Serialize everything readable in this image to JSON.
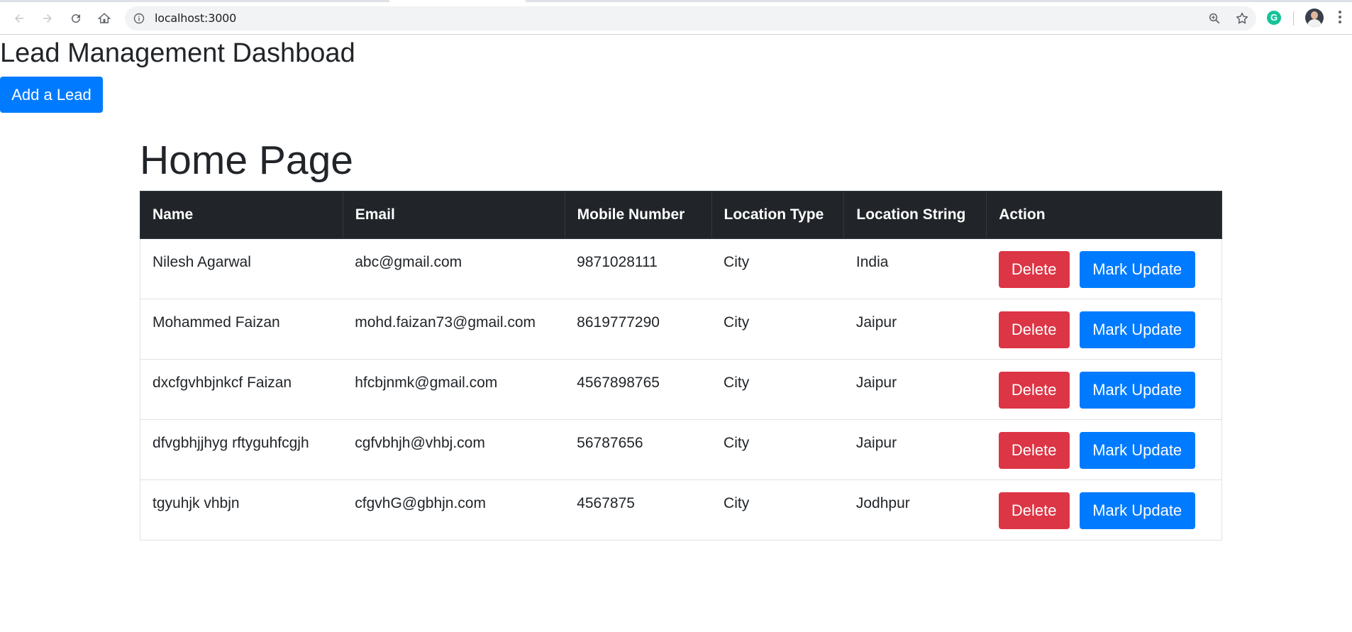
{
  "browser": {
    "url": "localhost:3000"
  },
  "page": {
    "dashboard_title": "Lead Management Dashboad",
    "add_lead_label": "Add a Lead",
    "home_title": "Home Page"
  },
  "table": {
    "headers": [
      "Name",
      "Email",
      "Mobile Number",
      "Location Type",
      "Location String",
      "Action"
    ],
    "rows": [
      {
        "name": "Nilesh Agarwal",
        "email": "abc@gmail.com",
        "mobile": "9871028111",
        "location_type": "City",
        "location_string": "India"
      },
      {
        "name": "Mohammed Faizan",
        "email": "mohd.faizan73@gmail.com",
        "mobile": "8619777290",
        "location_type": "City",
        "location_string": "Jaipur"
      },
      {
        "name": "dxcfgvhbjnkcf Faizan",
        "email": "hfcbjnmk@gmail.com",
        "mobile": "4567898765",
        "location_type": "City",
        "location_string": "Jaipur"
      },
      {
        "name": "dfvgbhjjhyg rftyguhfcgjh",
        "email": "cgfvbhjh@vhbj.com",
        "mobile": "56787656",
        "location_type": "City",
        "location_string": "Jaipur"
      },
      {
        "name": "tgyuhjk vhbjn",
        "email": "cfgvhG@gbhjn.com",
        "mobile": "4567875",
        "location_type": "City",
        "location_string": "Jodhpur"
      }
    ],
    "delete_label": "Delete",
    "update_label": "Mark Update"
  },
  "extension": {
    "letter": "G"
  },
  "colors": {
    "primary": "#007bff",
    "danger": "#dc3545",
    "table_header": "#212529"
  }
}
